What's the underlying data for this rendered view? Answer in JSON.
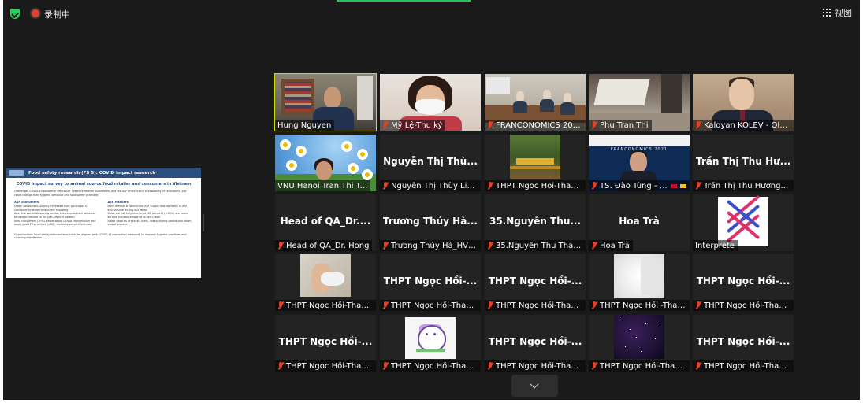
{
  "topbar": {
    "security_icon": "shield-check-icon",
    "recording_label": "录制中",
    "view_label": "视图",
    "accent_color": "#22c55e"
  },
  "share": {
    "title": "Food safety research (FS 5): COVID impact research",
    "subtitle": "COVID impact survey to animal source food retailer and consumers in Vietnam",
    "challenge": "Challenge: COVID-19 pandemic affect ASF livestock retailer businesses, and the ASF choices and accessibility of consumers, but could change their hygiene behavior and food safety practices",
    "consumers_title": "ASF consumers:",
    "consumers": [
      "Urban consumers: slightly increased their purchases in convenience stores and online shopping",
      "After the social distancing period, the consumption behavior tended to resume to the pre-Covid19 pattern",
      "Most consumers (70%) aware about COVID transmission and apply good FS practices (>80), model to prevent infection"
    ],
    "retailers_title": "ASF retailers:",
    "retailers": [
      "More difficult to source the ASF supply and decrease in ASF sale volume during lock down",
      "Sales are not fully recovered (65 percent) (>50%) and more service in rural compared to peri-urban",
      "Adopt good FS practices (GMS, mask) during partial lock down, and at present"
    ],
    "opportunities": "Opportunities:   Food safety interventions could be aligned with COVID-19 precaution measures to improve hygiene practices and cleaning/disinfection"
  },
  "participants": [
    {
      "name": "Hung Nguyen",
      "muted": false,
      "video": "office",
      "active": true
    },
    {
      "name": "Mỹ Lệ-Thu ký",
      "muted": true,
      "video": "mask"
    },
    {
      "name": "FRANCONOMICS 2021 - ...",
      "muted": true,
      "video": "class"
    },
    {
      "name": "Phu Tran Thi",
      "muted": true,
      "video": "room"
    },
    {
      "name": "Kaloyan KOLEV - OIF/...",
      "muted": true,
      "video": "suit"
    },
    {
      "name": "VNU Hanoi Tran Thi T...",
      "muted": false,
      "video": "daisy"
    },
    {
      "name": "Nguyễn Thị Thùy Linh...",
      "muted": true,
      "big": "Nguyễn Thị Thù..."
    },
    {
      "name": "THPT Ngoc Hoi-Than...",
      "muted": true,
      "video": "garden"
    },
    {
      "name": "TS. Đào Tùng - BTC",
      "muted": true,
      "video": "stage",
      "stage_text": "FRANCONOMICS 2021",
      "flags": true
    },
    {
      "name": "Trần Thị Thu Hương-...",
      "muted": true,
      "big": "Trần Thị Thu Hư..."
    },
    {
      "name": "Head of QA_Dr. Hong",
      "muted": true,
      "big": "Head of QA_Dr...."
    },
    {
      "name": "Trương Thúy Hà_HVP...",
      "muted": true,
      "big": "Trương Thúy Hà..."
    },
    {
      "name": "35.Nguyễn Thu Thảo ...",
      "muted": true,
      "big": "35.Nguyễn Thu..."
    },
    {
      "name": "Hoa Trà",
      "muted": true,
      "big": "Hoa Trà"
    },
    {
      "name": "Interprète",
      "muted": false,
      "video": "logo"
    },
    {
      "name": "THPT Ngọc Hồi-Than...",
      "muted": true,
      "video": "hand"
    },
    {
      "name": "THPT Ngọc Hồi-Than...",
      "muted": true,
      "big": "THPT Ngọc Hồi-..."
    },
    {
      "name": "THPT Ngọc Hồi-Than...",
      "muted": true,
      "big": "THPT Ngọc Hồi-..."
    },
    {
      "name": "THPT Ngọc Hồi -Than...",
      "muted": true,
      "video": "blur"
    },
    {
      "name": "THPT Ngọc Hồi-Than...",
      "muted": true,
      "big": "THPT Ngọc Hồi-..."
    },
    {
      "name": "THPT Ngọc Hồi-Than...",
      "muted": true,
      "big": "THPT Ngọc Hồi-..."
    },
    {
      "name": "THPT Ngọc Hồi-Than...",
      "muted": true,
      "video": "cartoon"
    },
    {
      "name": "THPT Ngọc Hồi-Than...",
      "muted": true,
      "big": "THPT Ngọc Hồi-..."
    },
    {
      "name": "THPT Ngọc Hồi-Than...",
      "muted": true,
      "video": "space"
    },
    {
      "name": "THPT Ngọc Hồi-Than...",
      "muted": true,
      "big": "THPT Ngọc Hồi-..."
    }
  ],
  "icons": {
    "muted": "mic-muted-icon",
    "collapse": "chevron-down-icon",
    "grid": "grid-view-icon"
  },
  "colors": {
    "background": "#1a1a1a",
    "tile": "#232323",
    "active_speaker": "#d2d900",
    "muted": "#e2412b"
  }
}
